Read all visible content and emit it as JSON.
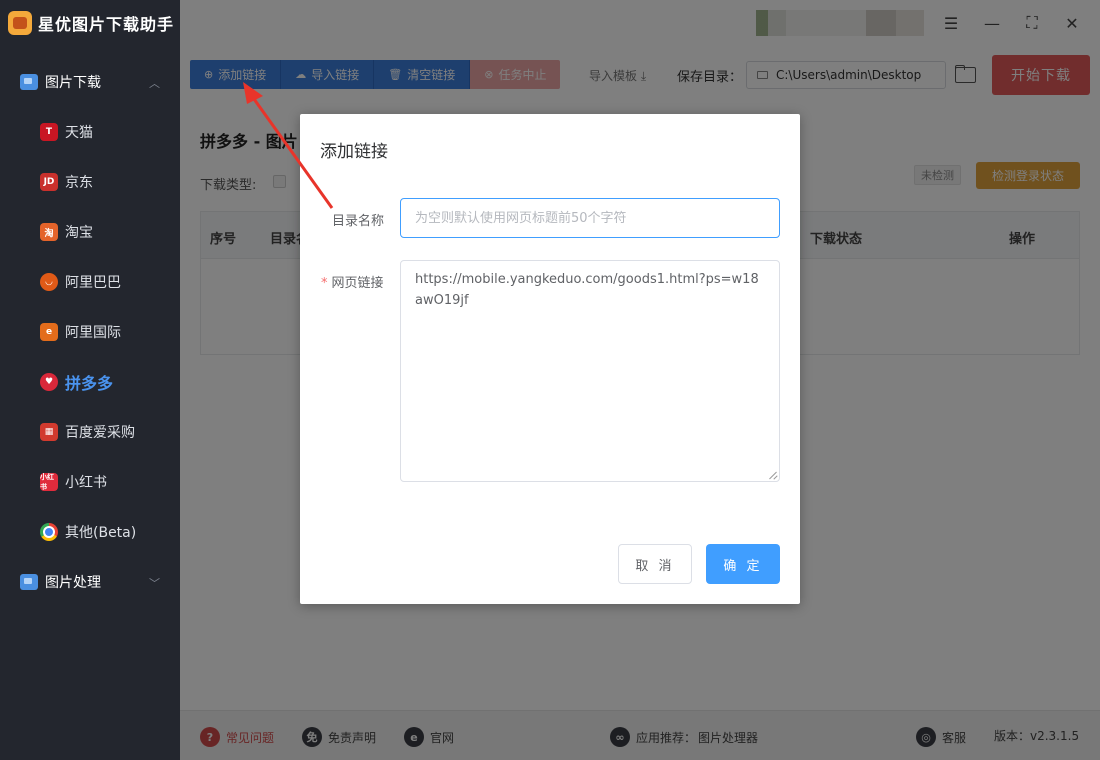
{
  "app": {
    "title": "星优图片下载助手"
  },
  "sidebar": {
    "group1": "图片下载",
    "items": [
      {
        "label": "天猫",
        "icon": "T"
      },
      {
        "label": "京东",
        "icon": "JD"
      },
      {
        "label": "淘宝",
        "icon": "淘"
      },
      {
        "label": "阿里巴巴",
        "icon": ""
      },
      {
        "label": "阿里国际",
        "icon": ""
      },
      {
        "label": "拼多多",
        "icon": ""
      },
      {
        "label": "百度爱采购",
        "icon": ""
      },
      {
        "label": "小红书",
        "icon": "小红书"
      },
      {
        "label": "其他(Beta)",
        "icon": ""
      }
    ],
    "active_index": 5,
    "group2": "图片处理"
  },
  "toolbar": {
    "add_link": "添加链接",
    "import_link": "导入链接",
    "clear_link": "清空链接",
    "stop_task": "任务中止",
    "import_template": "导入模板",
    "save_dir_label": "保存目录：",
    "save_dir_value": "C:\\Users\\admin\\Desktop",
    "start_download": "开始下载"
  },
  "content": {
    "page_title": "拼多多 - 图片",
    "download_type_label": "下载类型:",
    "status_badge": "未检测",
    "check_login": "检测登录状态",
    "columns": [
      "序号",
      "目录名",
      "下载状态",
      "操作"
    ]
  },
  "dialog": {
    "title": "添加链接",
    "dir_label": "目录名称",
    "dir_placeholder": "为空则默认使用网页标题前50个字符",
    "url_label": "网页链接",
    "url_value": "https://mobile.yangkeduo.com/goods1.html?ps=w18awO19jf",
    "cancel": "取 消",
    "ok": "确 定"
  },
  "footer": {
    "faq": "常见问题",
    "disclaimer": "免责声明",
    "website": "官网",
    "recommend_label": "应用推荐：",
    "recommend_app": "图片处理器",
    "support": "客服",
    "version": "版本：v2.3.1.5"
  },
  "colors": {
    "sidebar_bg": "#23262e",
    "primary": "#409eff",
    "toolbar_blue": "#3d7fdc",
    "start_red": "#e35b5b",
    "warning": "#e0a33c",
    "annotation_arrow": "#e8342a"
  }
}
